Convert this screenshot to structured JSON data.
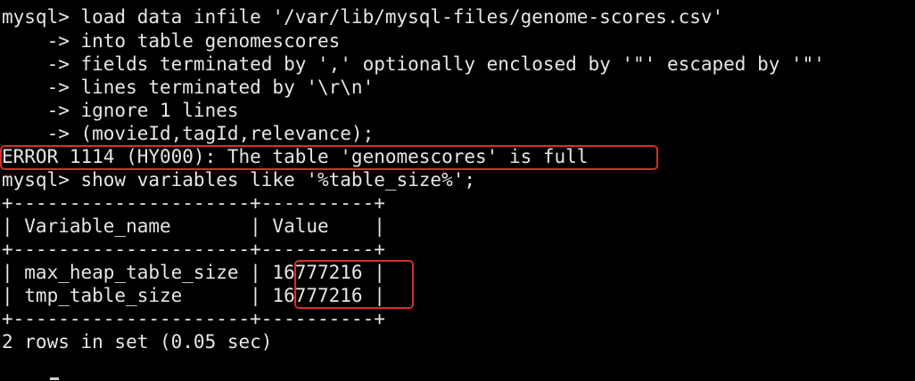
{
  "terminal": {
    "lines": [
      "mysql> load data infile '/var/lib/mysql-files/genome-scores.csv'",
      "    -> into table genomescores",
      "    -> fields terminated by ',' optionally enclosed by '\"' escaped by '\"'",
      "    -> lines terminated by '\\r\\n'",
      "    -> ignore 1 lines",
      "    -> (movieId,tagId,relevance);",
      "ERROR 1114 (HY000): The table 'genomescores' is full",
      "mysql> show variables like '%table_size%';",
      "+---------------------+----------+",
      "| Variable_name       | Value    |",
      "+---------------------+----------+",
      "| max_heap_table_size | 16777216 |",
      "| tmp_table_size      | 16777216 |",
      "+---------------------+----------+",
      "2 rows in set (0.05 sec)"
    ],
    "highlight_color": "#d93025",
    "text_color": "#e6e6e6",
    "background": "#000000"
  }
}
